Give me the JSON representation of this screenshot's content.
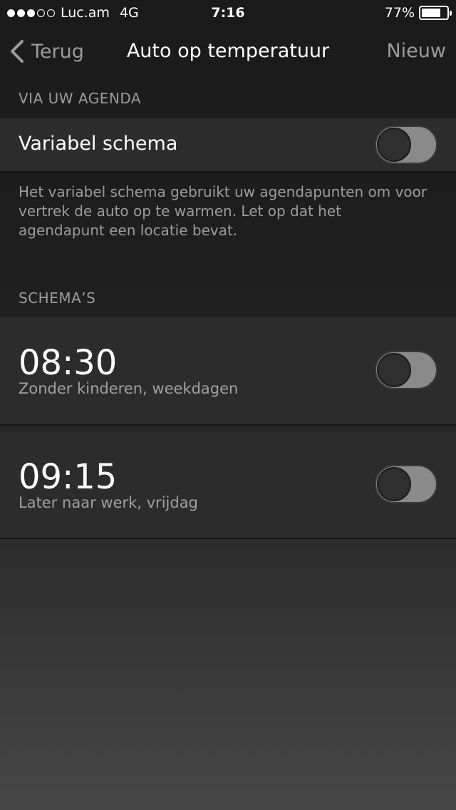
{
  "status_bar": {
    "carrier": "Luc.am",
    "network": "4G",
    "time": "7:16",
    "battery_percent_text": "77%",
    "battery_level": 0.77,
    "signal_dots_filled": 3,
    "signal_dots_total": 5
  },
  "nav": {
    "back_label": "Terug",
    "title": "Auto op temperatuur",
    "right_label": "Nieuw"
  },
  "agenda_section": {
    "header": "VIA UW AGENDA",
    "variable_schedule": {
      "label": "Variabel schema",
      "enabled": false
    },
    "note": "Het variabel schema gebruikt uw agendapunten om voor vertrek de auto op te warmen. Let op dat het agendapunt een locatie bevat."
  },
  "schedules_section": {
    "header": "SCHEMA’S",
    "items": [
      {
        "time": "08:30",
        "description": "Zonder kinderen, weekdagen",
        "enabled": false
      },
      {
        "time": "09:15",
        "description": "Later naar werk, vrijdag",
        "enabled": false
      }
    ]
  },
  "colors": {
    "cell_background": "#2c2c2c",
    "secondary_text": "#9b9b9b",
    "toggle_off_track": "#8a8a8a"
  },
  "icons": {
    "back": "chevron-left-icon",
    "battery": "battery-icon",
    "signal": "signal-dots-icon"
  }
}
